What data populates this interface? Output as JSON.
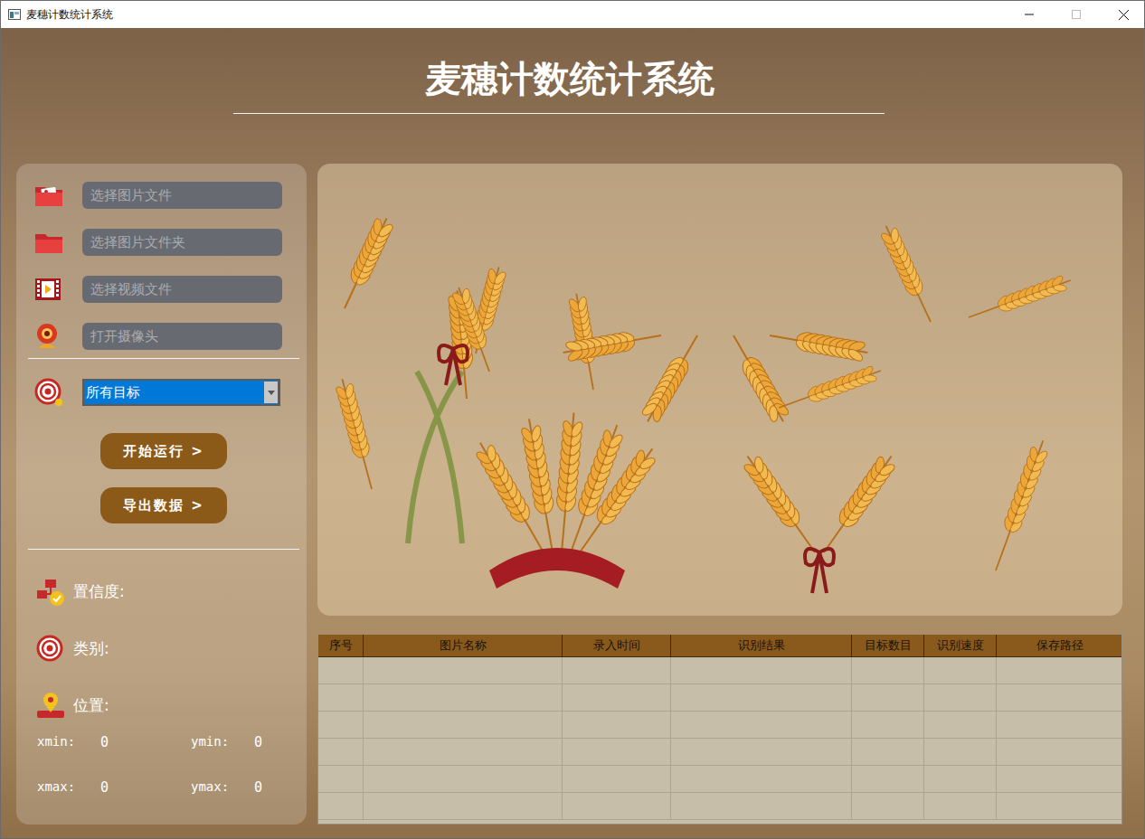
{
  "window": {
    "title": "麦穗计数统计系统"
  },
  "header": {
    "title": "麦穗计数统计系统"
  },
  "sources": [
    {
      "kind": "image",
      "placeholder": "选择图片文件"
    },
    {
      "kind": "folder",
      "placeholder": "选择图片文件夹"
    },
    {
      "kind": "video",
      "placeholder": "选择视频文件"
    },
    {
      "kind": "camera",
      "placeholder": "打开摄像头"
    }
  ],
  "target_select": {
    "value": "所有目标"
  },
  "buttons": [
    {
      "label": "开始运行 >"
    },
    {
      "label": "导出数据 >"
    }
  ],
  "info": [
    {
      "kind": "confidence",
      "label": "置信度:"
    },
    {
      "kind": "class",
      "label": "类别:"
    },
    {
      "kind": "location",
      "label": "位置:"
    }
  ],
  "coordinates": [
    {
      "label": "xmin:",
      "value": "0"
    },
    {
      "label": "ymin:",
      "value": "0"
    },
    {
      "label": "xmax:",
      "value": "0"
    },
    {
      "label": "ymax:",
      "value": "0"
    }
  ],
  "table": {
    "columns": [
      "序号",
      "图片名称",
      "录入时间",
      "识别结果",
      "目标数目",
      "识别速度",
      "保存路径"
    ],
    "rows": []
  }
}
